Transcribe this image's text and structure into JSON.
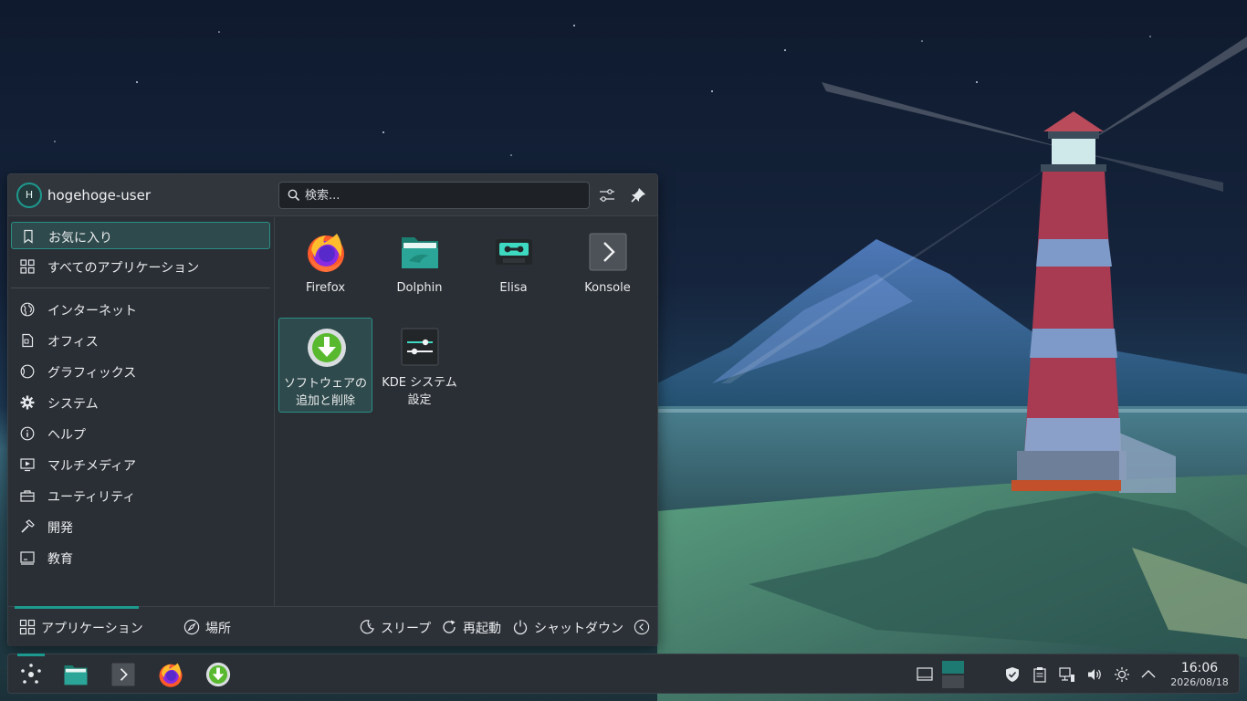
{
  "user": {
    "avatar_initial": "H",
    "name": "hogehoge-user"
  },
  "search": {
    "placeholder": "検索..."
  },
  "sidebar": {
    "items": [
      {
        "label": "お気に入り",
        "icon": "bookmark-icon",
        "active": true
      },
      {
        "label": "すべてのアプリケーション",
        "icon": "grid-icon"
      },
      {
        "label": "インターネット",
        "icon": "globe-icon"
      },
      {
        "label": "オフィス",
        "icon": "document-icon"
      },
      {
        "label": "グラフィックス",
        "icon": "graphics-icon"
      },
      {
        "label": "システム",
        "icon": "gear-icon"
      },
      {
        "label": "ヘルプ",
        "icon": "help-icon"
      },
      {
        "label": "マルチメディア",
        "icon": "multimedia-icon"
      },
      {
        "label": "ユーティリティ",
        "icon": "utilities-icon"
      },
      {
        "label": "開発",
        "icon": "hammer-icon"
      },
      {
        "label": "教育",
        "icon": "education-icon"
      }
    ]
  },
  "apps": [
    {
      "name": "Firefox",
      "icon": "firefox-icon"
    },
    {
      "name": "Dolphin",
      "icon": "dolphin-icon"
    },
    {
      "name": "Elisa",
      "icon": "elisa-icon"
    },
    {
      "name": "Konsole",
      "icon": "konsole-icon"
    },
    {
      "name_line1": "ソフトウェアの",
      "name_line2": "追加と削除",
      "icon": "discover-icon",
      "active": true
    },
    {
      "name_line1": "KDE システム",
      "name_line2": "設定",
      "icon": "settings-icon"
    }
  ],
  "footer": {
    "applications": "アプリケーション",
    "places": "場所",
    "sleep": "スリープ",
    "restart": "再起動",
    "shutdown": "シャットダウン"
  },
  "clock": {
    "time": "16:06",
    "date": "2026/08/18"
  },
  "colors": {
    "accent": "#1d9a8f",
    "panel": "#2a2f35"
  }
}
